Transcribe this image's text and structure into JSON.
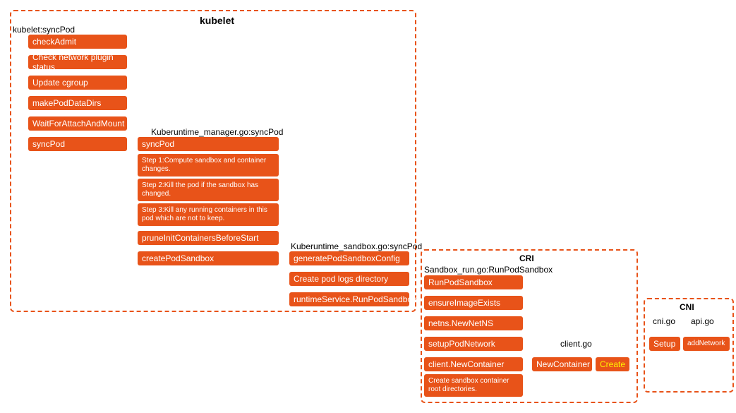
{
  "kubelet": {
    "title": "kubelet",
    "subhead": "kubelet:syncPod",
    "col1": {
      "checkAdmit": "checkAdmit",
      "checkNetworkPluginStatus": "Check network plugin status",
      "updateCgroup": "Update cgroup",
      "makePodDataDirs": "makePodDataDirs",
      "waitForAttachAndMount": "WaitForAttachAndMount",
      "syncPod": "syncPod"
    },
    "col2": {
      "subhead": "Kuberuntime_manager.go:syncPod",
      "syncPod": "syncPod",
      "step1": "Step 1:Compute sandbox and container changes.",
      "step2": "Step 2:Kill the pod if the sandbox has changed.",
      "step3": "Step 3:Kill any running containers in this pod which are not to keep.",
      "pruneInit": "pruneInitContainersBeforeStart",
      "createPodSandbox": "createPodSandbox"
    },
    "col3": {
      "subhead": "Kuberuntime_sandbox.go:syncPod",
      "generatePodSandboxConfig": "generatePodSandboxConfig",
      "createPodLogsDir": "Create pod logs directory",
      "runtimeServiceRun": "runtimeService.RunPodSandbox"
    }
  },
  "cri": {
    "title": "CRI",
    "subhead": "Sandbox_run.go:RunPodSandbox",
    "runPodSandbox": "RunPodSandbox",
    "ensureImageExists": "ensureImageExists",
    "netnsNewNetNS": "netns.NewNetNS",
    "setupPodNetwork": "setupPodNetwork",
    "clientNewContainer": "client.NewContainer",
    "createSandboxRootDirs": "Create sandbox container root directories.",
    "clientGo": "client.go",
    "newContainer": "NewContainer",
    "create": "Create"
  },
  "cni": {
    "title": "CNI",
    "cniGo": "cni.go",
    "apiGo": "api.go",
    "setup": "Setup",
    "addNetwork": "addNetwork"
  }
}
